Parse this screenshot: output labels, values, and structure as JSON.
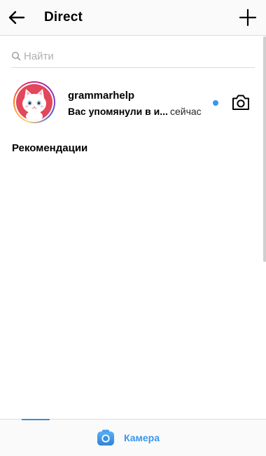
{
  "header": {
    "title": "Direct"
  },
  "search": {
    "placeholder": "Найти"
  },
  "threads": [
    {
      "name": "grammarhelp",
      "message": "Вас упомянули в и...",
      "time": "сейчас",
      "unread": true
    }
  ],
  "recommendations": {
    "title": "Рекомендации"
  },
  "bottom_bar": {
    "camera_label": "Камера"
  },
  "colors": {
    "accent": "#3897f0",
    "avatar_bg": "#e2475c",
    "divider": "#dbdbdb"
  },
  "icons": {
    "back": "arrow-left-icon",
    "new_message": "plus-icon",
    "search": "search-icon",
    "camera": "camera-icon"
  }
}
